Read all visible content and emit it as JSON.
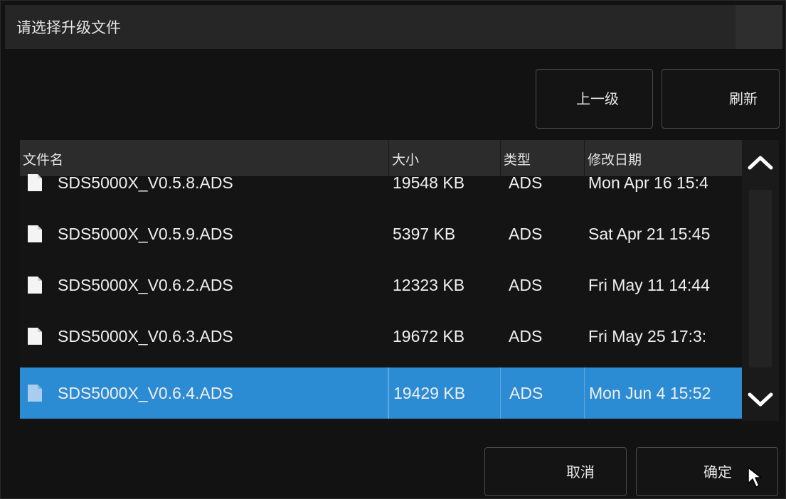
{
  "dialog": {
    "title": "请选择升级文件"
  },
  "toolbar": {
    "up_label": "上一级",
    "refresh_label": "刷新"
  },
  "table": {
    "columns": {
      "name": "文件名",
      "size": "大小",
      "type": "类型",
      "modified": "修改日期"
    },
    "rows": [
      {
        "name": "SDS5000X_V0.5.8.ADS",
        "size": "19548 KB",
        "type": "ADS",
        "modified": "Mon Apr 16 15:4",
        "selected": false
      },
      {
        "name": "SDS5000X_V0.5.9.ADS",
        "size": "5397 KB",
        "type": "ADS",
        "modified": "Sat Apr 21 15:45",
        "selected": false
      },
      {
        "name": "SDS5000X_V0.6.2.ADS",
        "size": "12323 KB",
        "type": "ADS",
        "modified": "Fri May 11 14:44",
        "selected": false
      },
      {
        "name": "SDS5000X_V0.6.3.ADS",
        "size": "19672 KB",
        "type": "ADS",
        "modified": "Fri May 25 17:3:",
        "selected": false
      },
      {
        "name": "SDS5000X_V0.6.4.ADS",
        "size": "19429 KB",
        "type": "ADS",
        "modified": "Mon Jun 4 15:52",
        "selected": true
      }
    ]
  },
  "footer": {
    "cancel_label": "取消",
    "ok_label": "确定"
  },
  "icons": {
    "file": "file-icon",
    "scroll_up": "chevron-up-icon",
    "scroll_down": "chevron-down-icon",
    "cursor": "mouse-pointer-icon"
  },
  "colors": {
    "selection": "#2b8bd3",
    "background": "#121212",
    "titlebar": "#262626",
    "text": "#efefef"
  }
}
